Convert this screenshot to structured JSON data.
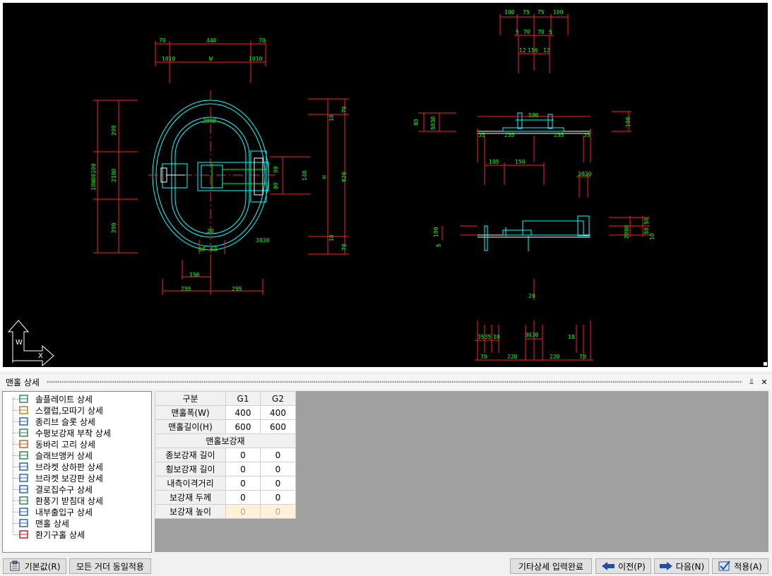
{
  "panel": {
    "title": "맨홀 상세",
    "pin_icon": "pin-icon",
    "close_icon": "close-icon"
  },
  "cad": {
    "axis_labels": {
      "y": "W",
      "x": "X"
    },
    "dims_plan": {
      "top": [
        "70",
        "440",
        "70"
      ],
      "top2": [
        "1010",
        "W",
        "1010"
      ],
      "left": [
        "290",
        "10W00100",
        "2100",
        "290"
      ],
      "inner": [
        "2880",
        "20",
        "60",
        "60",
        "3030"
      ],
      "right": [
        "90",
        "90",
        "140"
      ],
      "right2": [
        "10",
        "70",
        "10",
        "70",
        "H",
        "620"
      ],
      "bottom": [
        "150",
        "255",
        "255"
      ]
    },
    "dims_right": {
      "top1": [
        "100",
        "75",
        "75",
        "100"
      ],
      "top2": [
        "5",
        "70",
        "70",
        "5"
      ],
      "top3": [
        "12",
        "116",
        "12"
      ],
      "sect1": [
        "580",
        "35",
        "255",
        "255",
        "35"
      ],
      "sect1_left": [
        "80",
        "5030"
      ],
      "sect1_right": [
        "100"
      ],
      "mid": [
        "105",
        "150",
        "3030"
      ],
      "sect2_left": [
        "100",
        "5"
      ],
      "sect2_right": [
        "2080",
        "50",
        "50",
        "10"
      ],
      "bottom": [
        "20",
        "3535",
        "10",
        "3030",
        "10",
        "70",
        "220",
        "220",
        "70"
      ]
    }
  },
  "tree": {
    "items": [
      {
        "label": "솔플레이트 상세",
        "icon": "sole-plate-icon"
      },
      {
        "label": "스캘럽,모따기 상세",
        "icon": "scallop-icon"
      },
      {
        "label": "종리브 슬롯 상세",
        "icon": "rib-slot-icon"
      },
      {
        "label": "수평보강재 부착 상세",
        "icon": "stiffener-icon"
      },
      {
        "label": "동바리 고리 상세",
        "icon": "hook-icon"
      },
      {
        "label": "슬래브앵커 상세",
        "icon": "anchor-icon"
      },
      {
        "label": "브라켓 상하판 상세",
        "icon": "bracket-plate-icon"
      },
      {
        "label": "브라켓 보강판 상세",
        "icon": "bracket-stiffener-icon"
      },
      {
        "label": "결로집수구 상세",
        "icon": "drain-icon"
      },
      {
        "label": "환풍기 받침대 상세",
        "icon": "fan-support-icon"
      },
      {
        "label": "내부출입구 상세",
        "icon": "door-icon"
      },
      {
        "label": "맨홀 상세",
        "icon": "manhole-icon"
      },
      {
        "label": "환기구홀 상세",
        "icon": "vent-hole-icon"
      }
    ]
  },
  "grid": {
    "header": [
      "구분",
      "G1",
      "G2"
    ],
    "rows": [
      {
        "label": "맨홀폭(W)",
        "g1": "400",
        "g2": "400"
      },
      {
        "label": "맨홀길이(H)",
        "g1": "600",
        "g2": "600"
      }
    ],
    "section": "맨홀보강재",
    "rows2": [
      {
        "label": "종보강재 길이",
        "g1": "0",
        "g2": "0"
      },
      {
        "label": "횡보강재 길이",
        "g1": "0",
        "g2": "0"
      },
      {
        "label": "내측이격거리",
        "g1": "0",
        "g2": "0"
      },
      {
        "label": "보강재 두께",
        "g1": "0",
        "g2": "0"
      },
      {
        "label": "보강재 높이",
        "g1": "0",
        "g2": "0"
      }
    ]
  },
  "buttons": {
    "default": "기본값(R)",
    "apply_all": "모든 거더 동일적용",
    "complete": "기타상세 입력완료",
    "prev": "이전(P)",
    "next": "다음(N)",
    "apply": "적용(A)"
  }
}
